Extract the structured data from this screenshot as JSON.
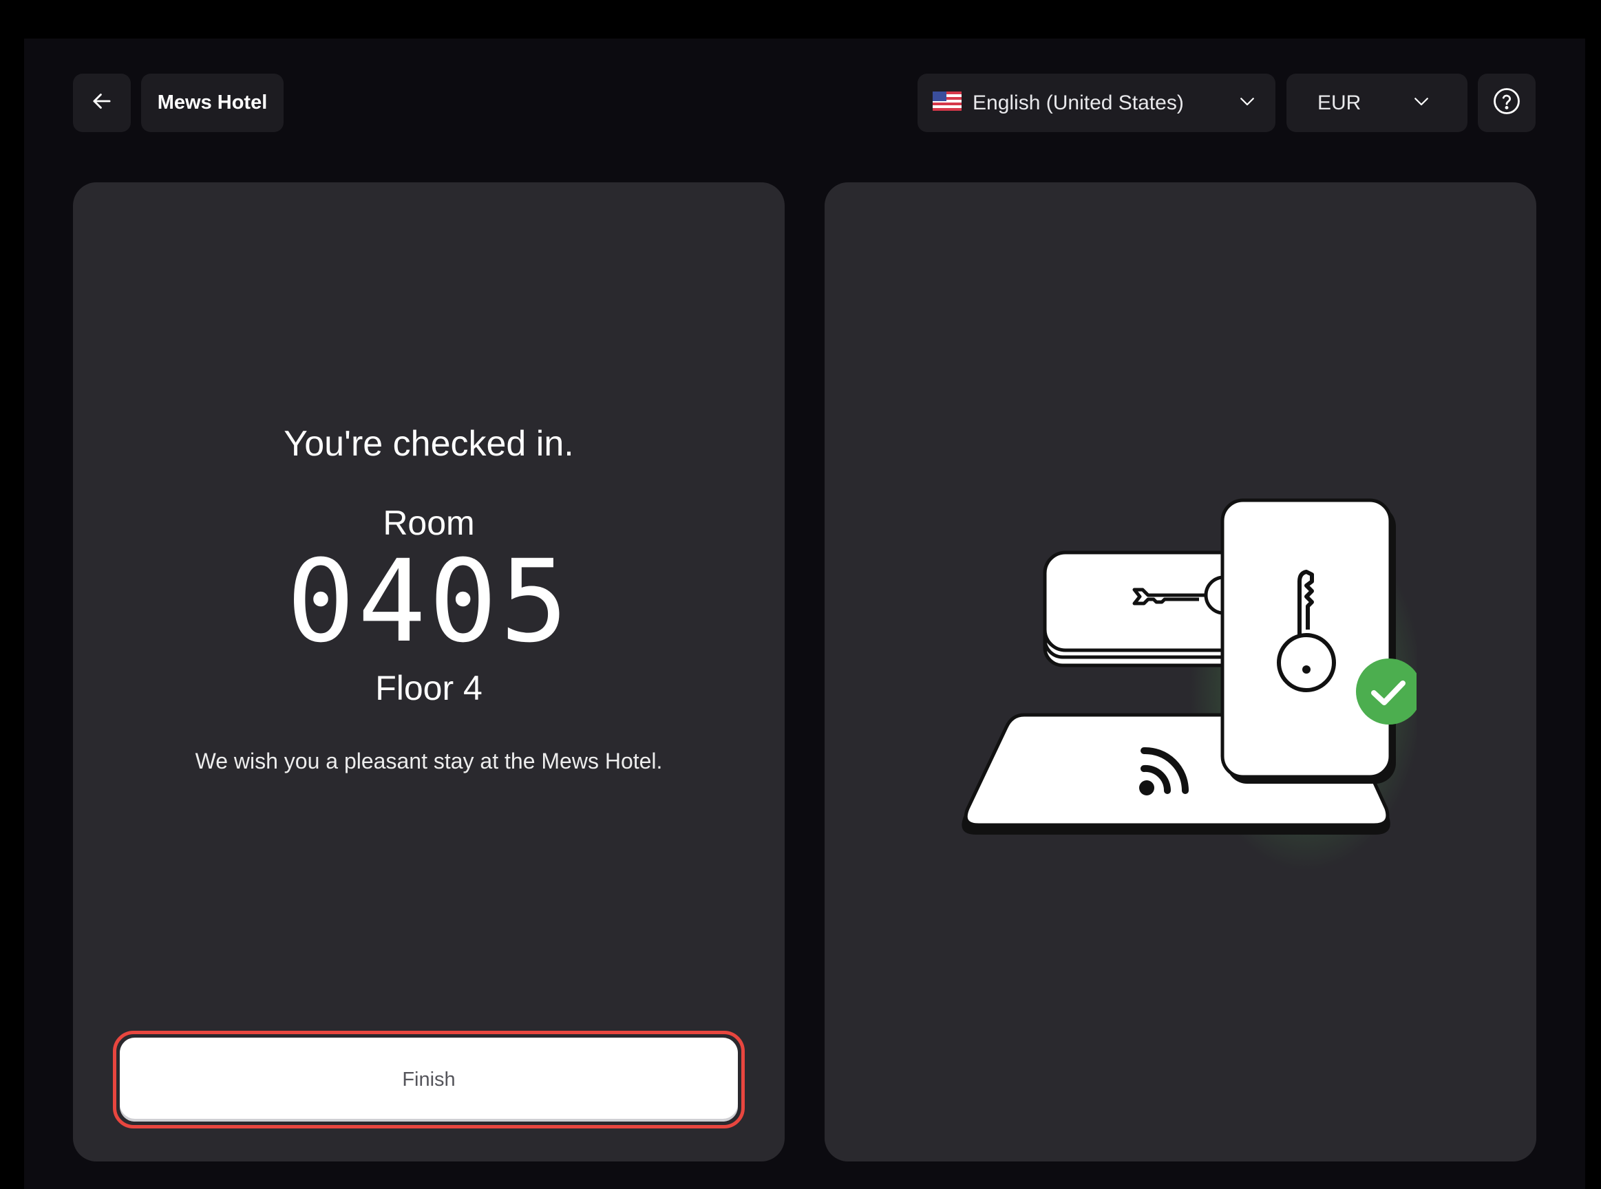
{
  "header": {
    "hotel_name": "Mews Hotel",
    "language": {
      "label": "English (United States)",
      "flag_icon": "us-flag-icon"
    },
    "currency": {
      "label": "EUR"
    }
  },
  "confirmation": {
    "title": "You're checked in.",
    "room_label": "Room",
    "room_number": "0405",
    "floor": "Floor 4",
    "message": "We wish you a pleasant stay at the Mews Hotel."
  },
  "actions": {
    "finish_label": "Finish"
  },
  "colors": {
    "background": "#0c0b10",
    "panel": "#2a292e",
    "header_control": "#1d1c21",
    "highlight_ring": "#e8463f",
    "success": "#4cae4f"
  }
}
